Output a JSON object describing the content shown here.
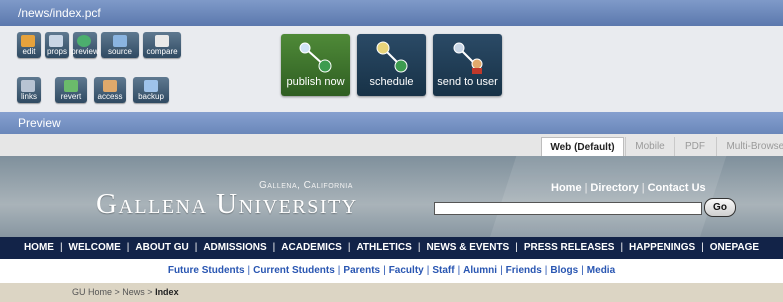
{
  "window": {
    "path": "/news/index.pcf"
  },
  "toolbar": {
    "small_buttons": [
      {
        "label": "edit",
        "icon": "pencil-icon",
        "color": "#e6a23c"
      },
      {
        "label": "props",
        "icon": "magnifier-icon",
        "color": "#c9d6e6"
      },
      {
        "label": "preview",
        "icon": "globe-icon",
        "color": "#4caf6e"
      },
      {
        "label": "source",
        "icon": "code-page-icon",
        "color": "#8ab4e0"
      },
      {
        "label": "compare",
        "icon": "compare-pages-icon",
        "color": "#e9e9e9"
      },
      {
        "label": "links",
        "icon": "chain-icon",
        "color": "#b7c3d3"
      },
      {
        "label": "revert",
        "icon": "revert-arrow-icon",
        "color": "#6bbb6b"
      },
      {
        "label": "access",
        "icon": "people-icon",
        "color": "#e0a96b"
      },
      {
        "label": "backup",
        "icon": "page-stack-icon",
        "color": "#9fc3ea"
      }
    ],
    "actions": {
      "publish": {
        "label": "publish now",
        "icon": "publish-globe-icon",
        "color": "#4f8a38"
      },
      "schedule": {
        "label": "schedule",
        "icon": "clock-globe-icon",
        "color": "#173247"
      },
      "send": {
        "label": "send to user",
        "icon": "send-user-icon",
        "color": "#173247"
      }
    }
  },
  "preview_bar": {
    "label": "Preview"
  },
  "preview_tabs": [
    "Web (Default)",
    "Mobile",
    "PDF",
    "Multi-Browser"
  ],
  "site": {
    "city": "Gallena, California",
    "university": "Gallena University",
    "top_links": [
      "Home",
      "Directory",
      "Contact Us"
    ],
    "search_value": "",
    "go_label": "Go",
    "main_nav": [
      "HOME",
      "WELCOME",
      "ABOUT GU",
      "ADMISSIONS",
      "ACADEMICS",
      "ATHLETICS",
      "NEWS & EVENTS",
      "PRESS RELEASES",
      "HAPPENINGS",
      "ONEPAGE"
    ],
    "audience_nav": [
      "Future Students",
      "Current Students",
      "Parents",
      "Faculty",
      "Staff",
      "Alumni",
      "Friends",
      "Blogs",
      "Media"
    ],
    "breadcrumb": [
      "GU Home",
      "News",
      "Index"
    ]
  }
}
